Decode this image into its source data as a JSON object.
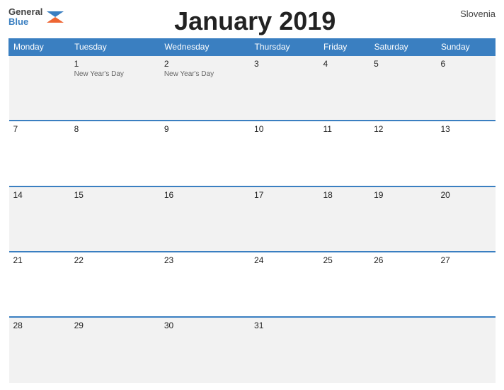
{
  "header": {
    "logo_general": "General",
    "logo_blue": "Blue",
    "title": "January 2019",
    "country": "Slovenia"
  },
  "days_of_week": [
    "Monday",
    "Tuesday",
    "Wednesday",
    "Thursday",
    "Friday",
    "Saturday",
    "Sunday"
  ],
  "weeks": [
    [
      {
        "day": "",
        "holiday": ""
      },
      {
        "day": "1",
        "holiday": "New Year's Day"
      },
      {
        "day": "2",
        "holiday": "New Year's Day"
      },
      {
        "day": "3",
        "holiday": ""
      },
      {
        "day": "4",
        "holiday": ""
      },
      {
        "day": "5",
        "holiday": ""
      },
      {
        "day": "6",
        "holiday": ""
      }
    ],
    [
      {
        "day": "7",
        "holiday": ""
      },
      {
        "day": "8",
        "holiday": ""
      },
      {
        "day": "9",
        "holiday": ""
      },
      {
        "day": "10",
        "holiday": ""
      },
      {
        "day": "11",
        "holiday": ""
      },
      {
        "day": "12",
        "holiday": ""
      },
      {
        "day": "13",
        "holiday": ""
      }
    ],
    [
      {
        "day": "14",
        "holiday": ""
      },
      {
        "day": "15",
        "holiday": ""
      },
      {
        "day": "16",
        "holiday": ""
      },
      {
        "day": "17",
        "holiday": ""
      },
      {
        "day": "18",
        "holiday": ""
      },
      {
        "day": "19",
        "holiday": ""
      },
      {
        "day": "20",
        "holiday": ""
      }
    ],
    [
      {
        "day": "21",
        "holiday": ""
      },
      {
        "day": "22",
        "holiday": ""
      },
      {
        "day": "23",
        "holiday": ""
      },
      {
        "day": "24",
        "holiday": ""
      },
      {
        "day": "25",
        "holiday": ""
      },
      {
        "day": "26",
        "holiday": ""
      },
      {
        "day": "27",
        "holiday": ""
      }
    ],
    [
      {
        "day": "28",
        "holiday": ""
      },
      {
        "day": "29",
        "holiday": ""
      },
      {
        "day": "30",
        "holiday": ""
      },
      {
        "day": "31",
        "holiday": ""
      },
      {
        "day": "",
        "holiday": ""
      },
      {
        "day": "",
        "holiday": ""
      },
      {
        "day": "",
        "holiday": ""
      }
    ]
  ]
}
